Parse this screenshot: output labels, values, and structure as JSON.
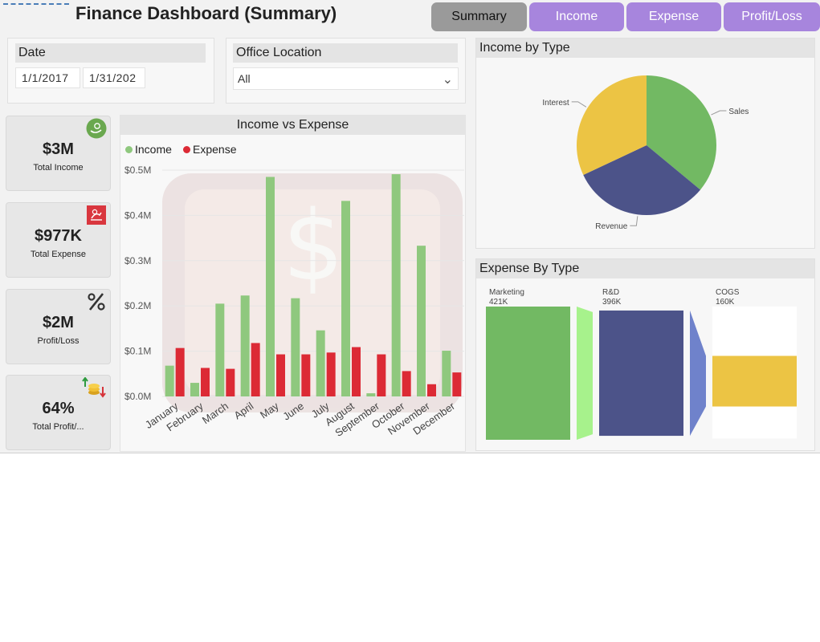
{
  "header": {
    "title": "Finance Dashboard (Summary)",
    "tabs": [
      {
        "label": "Summary",
        "active": true
      },
      {
        "label": "Income",
        "active": false
      },
      {
        "label": "Expense",
        "active": false
      },
      {
        "label": "Profit/Loss",
        "active": false
      }
    ]
  },
  "filters": {
    "date": {
      "label": "Date",
      "start": "1/1/2017",
      "end": "1/31/202"
    },
    "office": {
      "label": "Office Location",
      "value": "All"
    }
  },
  "kpis": [
    {
      "value": "$3M",
      "label": "Total Income",
      "icon": "money-hand-icon"
    },
    {
      "value": "$977K",
      "label": "Total Expense",
      "icon": "expense-icon"
    },
    {
      "value": "$2M",
      "label": "Profit/Loss",
      "icon": "percent-icon"
    },
    {
      "value": "64%",
      "label": "Total Profit/...",
      "icon": "coins-up-down-icon"
    }
  ],
  "colors": {
    "income": "#8fc87e",
    "expense": "#dc2a35",
    "marketing": "#72b963",
    "marketing_link": "#a7f28c",
    "rd": "#4c5389",
    "rd_link": "#6f82cb",
    "cogs": "#ecc444",
    "pie_sales": "#72b963",
    "pie_revenue": "#4c5389",
    "pie_interest": "#ecc444",
    "tab_active": "#9a9a9a",
    "tab_idle": "#a785dd"
  },
  "chart_data": [
    {
      "type": "bar",
      "title": "Income vs Expense",
      "categories": [
        "January",
        "February",
        "March",
        "April",
        "May",
        "June",
        "July",
        "August",
        "September",
        "October",
        "November",
        "December"
      ],
      "series": [
        {
          "name": "Income",
          "values": [
            0.068,
            0.03,
            0.205,
            0.223,
            0.485,
            0.217,
            0.146,
            0.432,
            0.007,
            0.491,
            0.333,
            0.101
          ]
        },
        {
          "name": "Expense",
          "values": [
            0.107,
            0.063,
            0.061,
            0.118,
            0.093,
            0.093,
            0.097,
            0.109,
            0.093,
            0.056,
            0.027,
            0.053
          ]
        }
      ],
      "ytick_labels": [
        "$0.0M",
        "$0.1M",
        "$0.2M",
        "$0.3M",
        "$0.4M",
        "$0.5M"
      ],
      "ylim": [
        0,
        0.5
      ],
      "grid": true,
      "legend": "top-left"
    },
    {
      "type": "pie",
      "title": "Income by Type",
      "labels": [
        "Sales",
        "Revenue",
        "Interest"
      ],
      "values": [
        36,
        32,
        32
      ]
    },
    {
      "type": "bar",
      "title": "Expense By Type",
      "categories": [
        "Marketing",
        "R&D",
        "COGS"
      ],
      "value_labels": [
        "421K",
        "396K",
        "160K"
      ],
      "values": [
        421,
        396,
        160
      ]
    }
  ]
}
